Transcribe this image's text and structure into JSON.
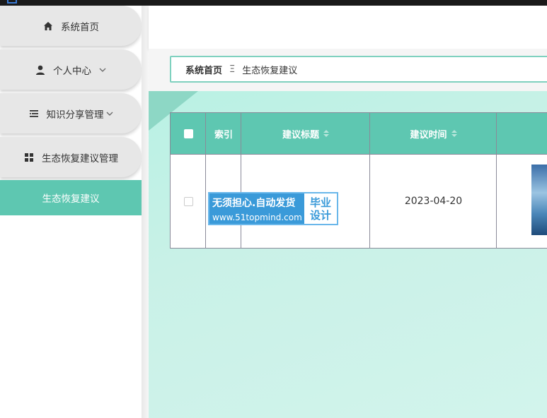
{
  "sidebar": {
    "items": [
      {
        "label": "系统首页",
        "icon": "home-icon"
      },
      {
        "label": "个人中心",
        "icon": "user-icon"
      },
      {
        "label": "知识分享管理",
        "icon": "list-icon"
      },
      {
        "label": "生态恢复建议管理",
        "icon": "grid-icon"
      }
    ],
    "submenu_active": "生态恢复建议"
  },
  "breadcrumb": {
    "home": "系统首页",
    "separator": "Ξ",
    "current": "生态恢复建议"
  },
  "table": {
    "headers": {
      "index": "索引",
      "title": "建议标题",
      "time": "建议时间"
    },
    "rows": [
      {
        "time": "2023-04-20"
      }
    ]
  },
  "watermark": {
    "line1": "无须担心.自动发货",
    "line2": "www.51topmind.com",
    "badge1": "毕业",
    "badge2": "设计"
  },
  "colors": {
    "accent": "#5ec7b1",
    "menu_bg": "#e7e7e7"
  }
}
